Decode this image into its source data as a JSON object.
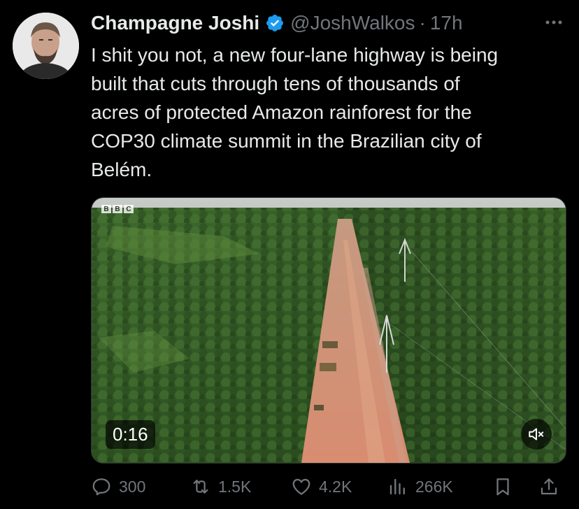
{
  "tweet": {
    "author_name": "Champagne Joshi",
    "handle": "@JoshWalkos",
    "separator": "·",
    "time": "17h",
    "text_lines": [
      "I shit you not, a new four-lane highway is being",
      "built that cuts through tens of thousands of",
      "acres of protected Amazon rainforest for the",
      "COP30 climate summit in the Brazilian city of",
      "Belém."
    ]
  },
  "media": {
    "duration": "0:16",
    "logo_letters": [
      "B",
      "B",
      "C"
    ]
  },
  "actions": {
    "replies": "300",
    "reposts": "1.5K",
    "likes": "4.2K",
    "views": "266K"
  },
  "colors": {
    "background": "#000000",
    "text": "#e7e9ea",
    "muted": "#71767b",
    "verified": "#1d9bf0"
  },
  "icons": [
    "verified-badge-icon",
    "more-icon",
    "mute-icon",
    "reply-icon",
    "repost-icon",
    "like-icon",
    "views-icon",
    "bookmark-icon",
    "share-icon"
  ]
}
